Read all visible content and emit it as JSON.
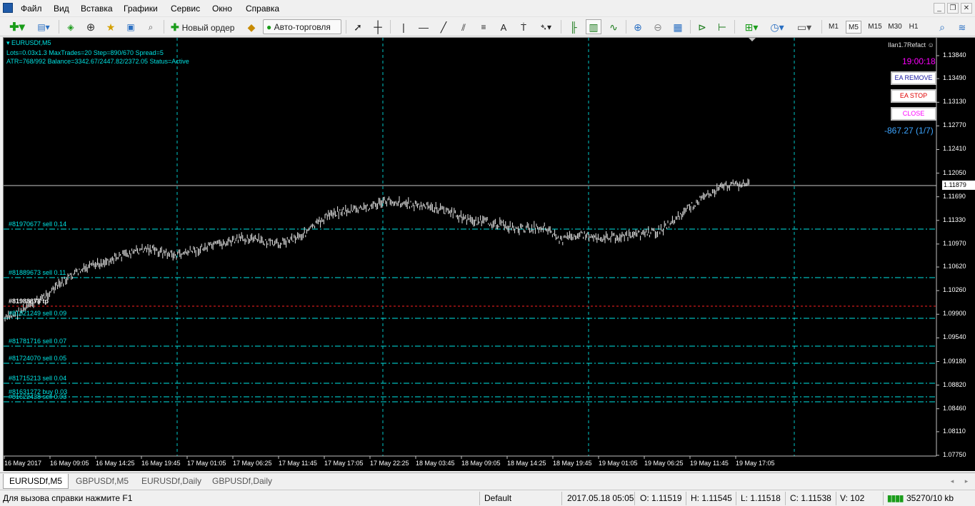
{
  "menu": [
    "Файл",
    "Вид",
    "Вставка",
    "Графики",
    "Сервис",
    "Окно",
    "Справка"
  ],
  "toolbar": {
    "new_order": "Новый ордер",
    "auto_trading": "Авто-торговля",
    "timeframes": [
      "M1",
      "M5",
      "M15",
      "M30",
      "H1"
    ],
    "active_timeframe": "M5"
  },
  "chart": {
    "symbol": "EURUSDf,M5",
    "info_line1": "Lots=0.03x1.3 MaxTrades=20 Step=890/670 Spread=5",
    "info_line2": "ATR=768/992 Balance=3342.67/2447.82/2372.05 Status=Active",
    "ea_name": "Ilan1.7Refact",
    "clock": "19:00:18",
    "buttons": {
      "remove": "EA REMOVE",
      "stop": "EA STOP",
      "close": "CLOSE"
    },
    "profit": "-867.27 (1/7)",
    "current_price": "1.11879",
    "price_axis": [
      "1.13840",
      "1.13490",
      "1.13130",
      "1.12770",
      "1.12410",
      "1.12050",
      "1.11690",
      "1.11330",
      "1.10970",
      "1.10620",
      "1.10260",
      "1.09900",
      "1.09540",
      "1.09180",
      "1.08820",
      "1.08460",
      "1.08110",
      "1.07750"
    ],
    "time_axis": [
      "16 May 2017",
      "16 May 09:05",
      "16 May 14:25",
      "16 May 19:45",
      "17 May 01:05",
      "17 May 06:25",
      "17 May 11:45",
      "17 May 17:05",
      "17 May 22:25",
      "18 May 03:45",
      "18 May 09:05",
      "18 May 14:25",
      "18 May 19:45",
      "19 May 01:05",
      "19 May 06:25",
      "19 May 11:45",
      "19 May 17:05"
    ],
    "orders": [
      "#81970677 sell 0.14",
      "#81889673 sell 0.11",
      "#81988878 tp",
      "#81821249 sell 0.09",
      "#81781716 sell 0.07",
      "#81724070 sell 0.05",
      "#81715213 sell 0.04",
      "#81631272 buy 0.03",
      "#81622438 sell 0.03"
    ],
    "colors": {
      "background": "#000000",
      "grid": "#00c8c8",
      "price": "#ffffff",
      "order_line": "#00e6e6",
      "tp_line": "#ff2020",
      "clock": "#ff00ff",
      "profit": "#3da5ff"
    }
  },
  "tabs": [
    "EURUSDf,M5",
    "GBPUSDf,M5",
    "EURUSDf,Daily",
    "GBPUSDf,Daily"
  ],
  "active_tab": "EURUSDf,M5",
  "status": {
    "help": "Для вызова справки нажмите F1",
    "profile": "Default",
    "datetime": "2017.05.18 05:05",
    "open": "O: 1.11519",
    "high": "H: 1.11545",
    "low": "L: 1.11518",
    "close": "C: 1.11538",
    "volume": "V: 102",
    "traffic": "35270/10 kb"
  }
}
